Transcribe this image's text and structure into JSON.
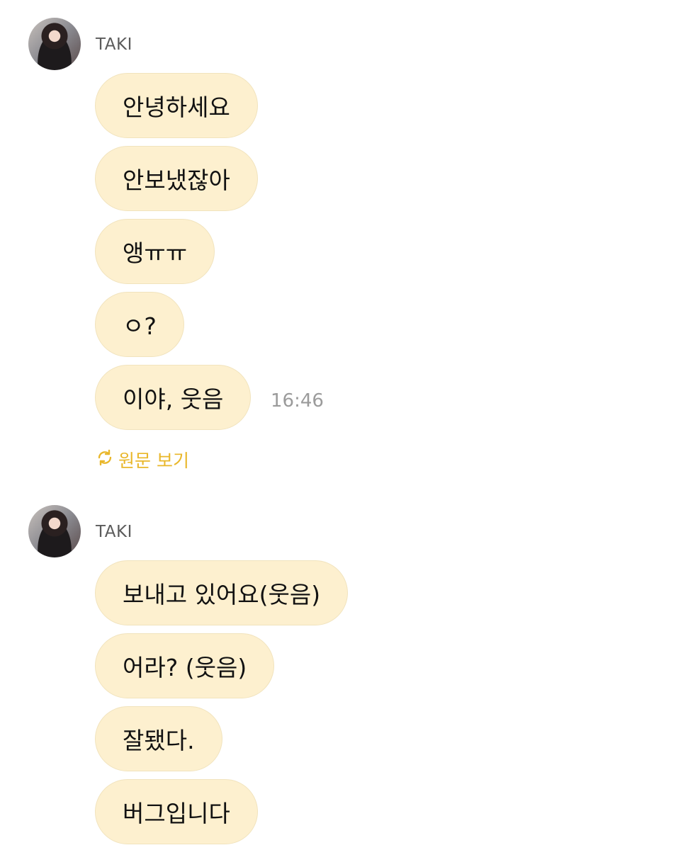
{
  "groups": [
    {
      "sender": "TAKI",
      "messages": [
        "안녕하세요",
        "안보냈잖아",
        "앵ㅠㅠ",
        "ㅇ?",
        "이야, 웃음"
      ],
      "time": "16:46",
      "translate_label": "원문 보기"
    },
    {
      "sender": "TAKI",
      "messages": [
        "보내고 있어요(웃음)",
        "어라? (웃음)",
        "잘됐다.",
        "버그입니다"
      ]
    }
  ],
  "colors": {
    "bubble": "#fdf0cf",
    "translate": "#e9b72a"
  },
  "icons": {
    "translate": "translate-icon",
    "avatar": "profile-avatar"
  }
}
